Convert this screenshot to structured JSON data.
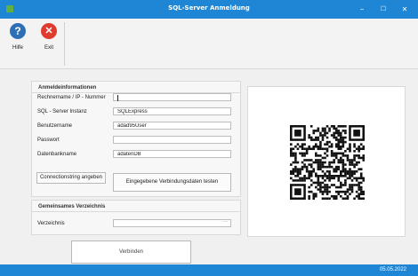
{
  "window": {
    "title": "SQL-Server Anmeldung",
    "minimize_glyph": "−",
    "maximize_glyph": "☐",
    "close_glyph": "✕"
  },
  "ribbon": {
    "help": {
      "label": "Hilfe",
      "icon": "?"
    },
    "exit": {
      "label": "Exit",
      "icon": "✕"
    }
  },
  "login": {
    "section_title": "Anmeldeinformationen",
    "fields": [
      {
        "label": "Rechnername / IP - Nummer",
        "value": ""
      },
      {
        "label": "SQL - Server Instanz",
        "value": "SQLExpress"
      },
      {
        "label": "Benutzername",
        "value": "adad95User"
      },
      {
        "label": "Passwort",
        "value": ""
      },
      {
        "label": "Datenbankname",
        "value": "adatenDB"
      }
    ],
    "connstring_button": "Connectionstring angeben",
    "test_button": "Eingegebene Verbindungsdaten testen"
  },
  "directory": {
    "section_title": "Gemeinsames Verzeichnis",
    "label": "Verzeichnis",
    "value": "",
    "browse_glyph": "···"
  },
  "connect_button": "Verbinden",
  "status": {
    "date": "05.05.2022"
  },
  "colors": {
    "accent": "#1e86d5",
    "help_icon": "#2d6fb7",
    "exit_icon": "#e03a2e"
  }
}
